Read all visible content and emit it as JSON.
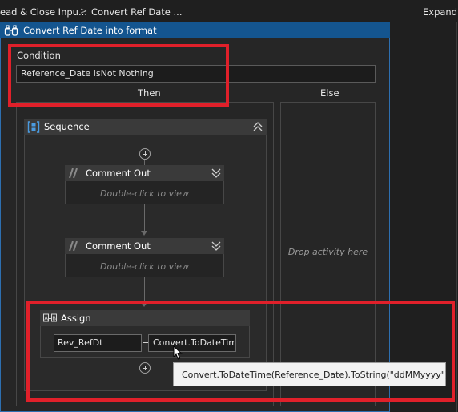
{
  "breadcrumb": {
    "items": [
      "ead & Close Inpu...",
      "Convert Ref Date ..."
    ],
    "separator": ">",
    "expand_label": "Expand A"
  },
  "if_activity": {
    "title": "Convert Ref Date into format",
    "condition_label": "Condition",
    "condition_value": "Reference_Date IsNot Nothing",
    "then_label": "Then",
    "else_label": "Else",
    "else_placeholder": "Drop activity here"
  },
  "sequence": {
    "title": "Sequence",
    "comments": [
      {
        "title": "Comment Out",
        "hint": "Double-click to view"
      },
      {
        "title": "Comment Out",
        "hint": "Double-click to view"
      }
    ]
  },
  "assign": {
    "title": "Assign",
    "to": "Rev_RefDt",
    "equals": "=",
    "value": "Convert.ToDateTime"
  },
  "tooltip": {
    "text": "Convert.ToDateTime(Reference_Date).ToString(\"ddMMyyyy\")"
  },
  "colors": {
    "background": "#1f1f1f",
    "if_header": "#14558f",
    "highlight": "#e0202a",
    "panel": "#262626"
  },
  "icons": [
    "binoculars-icon",
    "sequence-icon",
    "collapse-icon",
    "add-activity-icon",
    "comment-out-icon",
    "expand-chevron-icon",
    "assign-icon",
    "mouse-cursor-icon"
  ]
}
